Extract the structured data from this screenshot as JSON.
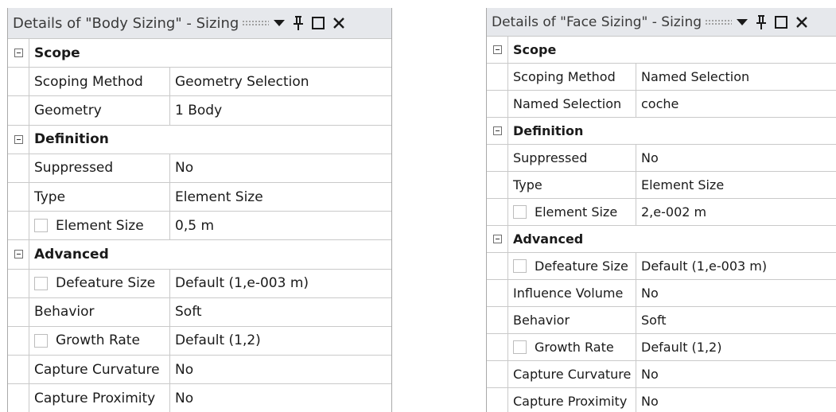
{
  "panels": [
    {
      "title": "Details of \"Body Sizing\" - Sizing",
      "groups": [
        {
          "label": "Scope",
          "rows": [
            {
              "name": "Scoping Method",
              "value": "Geometry Selection",
              "checkbox": false
            },
            {
              "name": "Geometry",
              "value": "1 Body",
              "checkbox": false
            }
          ]
        },
        {
          "label": "Definition",
          "rows": [
            {
              "name": "Suppressed",
              "value": "No",
              "checkbox": false
            },
            {
              "name": "Type",
              "value": "Element Size",
              "checkbox": false
            },
            {
              "name": "Element Size",
              "value": "0,5 m",
              "checkbox": true
            }
          ]
        },
        {
          "label": "Advanced",
          "rows": [
            {
              "name": "Defeature Size",
              "value": "Default (1,e-003 m)",
              "checkbox": true
            },
            {
              "name": "Behavior",
              "value": "Soft",
              "checkbox": false
            },
            {
              "name": "Growth Rate",
              "value": "Default (1,2)",
              "checkbox": true
            },
            {
              "name": "Capture Curvature",
              "value": "No",
              "checkbox": false
            },
            {
              "name": "Capture Proximity",
              "value": "No",
              "checkbox": false
            }
          ]
        }
      ]
    },
    {
      "title": "Details of \"Face Sizing\" - Sizing",
      "groups": [
        {
          "label": "Scope",
          "rows": [
            {
              "name": "Scoping Method",
              "value": "Named Selection",
              "checkbox": false
            },
            {
              "name": "Named Selection",
              "value": "coche",
              "checkbox": false
            }
          ]
        },
        {
          "label": "Definition",
          "rows": [
            {
              "name": "Suppressed",
              "value": "No",
              "checkbox": false
            },
            {
              "name": "Type",
              "value": "Element Size",
              "checkbox": false
            },
            {
              "name": "Element Size",
              "value": "2,e-002 m",
              "checkbox": true
            }
          ]
        },
        {
          "label": "Advanced",
          "rows": [
            {
              "name": "Defeature Size",
              "value": "Default (1,e-003 m)",
              "checkbox": true
            },
            {
              "name": "Influence Volume",
              "value": "No",
              "checkbox": false
            },
            {
              "name": "Behavior",
              "value": "Soft",
              "checkbox": false
            },
            {
              "name": "Growth Rate",
              "value": "Default (1,2)",
              "checkbox": true
            },
            {
              "name": "Capture Curvature",
              "value": "No",
              "checkbox": false
            },
            {
              "name": "Capture Proximity",
              "value": "No",
              "checkbox": false
            }
          ]
        }
      ]
    }
  ],
  "title_bar_icons": [
    "dropdown-arrow-icon",
    "pin-icon",
    "maximize-icon",
    "close-icon"
  ]
}
